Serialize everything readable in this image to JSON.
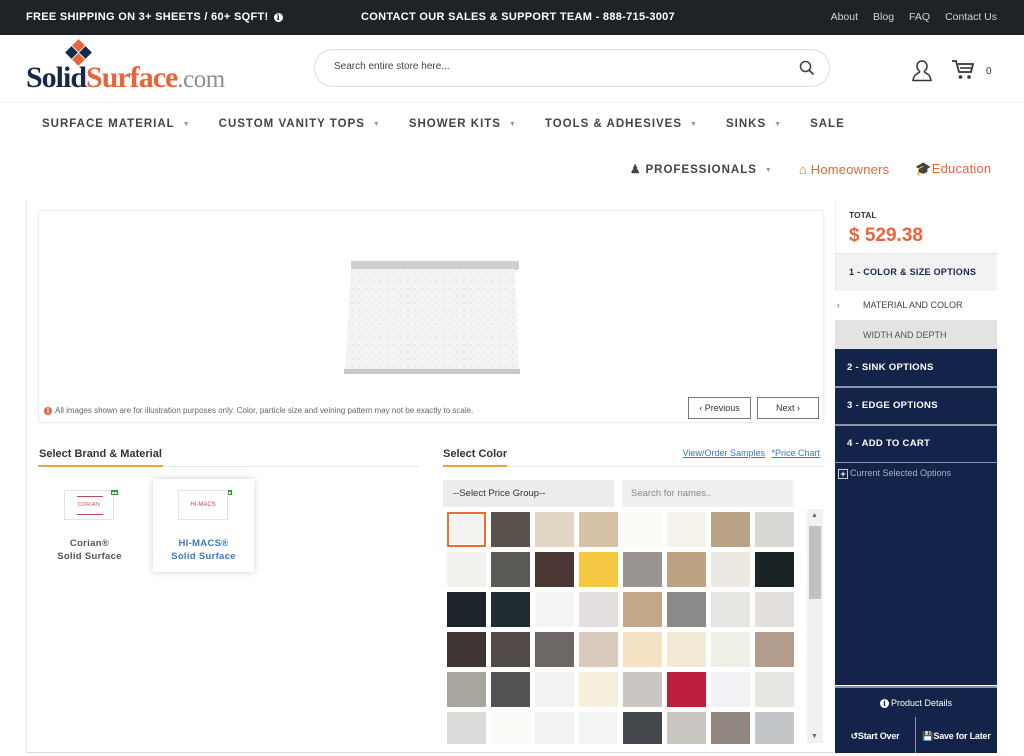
{
  "topbar": {
    "shipping": "FREE SHIPPING ON 3+ SHEETS / 60+ SQFT!",
    "info_icon": "info-circle-icon",
    "contact": "CONTACT OUR SALES & SUPPORT TEAM - 888-715-3007",
    "links": [
      "About",
      "Blog",
      "FAQ",
      "Contact Us"
    ]
  },
  "header": {
    "logo": {
      "part1": "Solid",
      "part2": "Surface",
      "part3": ".com"
    },
    "search_placeholder": "Search entire store here...",
    "cart_count": "0"
  },
  "nav": {
    "main": [
      {
        "label": "SURFACE MATERIAL",
        "dropdown": true
      },
      {
        "label": "CUSTOM VANITY TOPS",
        "dropdown": true
      },
      {
        "label": "SHOWER KITS",
        "dropdown": true
      },
      {
        "label": "TOOLS & ADHESIVES",
        "dropdown": true
      },
      {
        "label": "SINKS",
        "dropdown": true
      },
      {
        "label": "SALE",
        "dropdown": false
      }
    ],
    "professionals": "PROFESSIONALS",
    "homeowners": "Homeowners",
    "education": "Education"
  },
  "viewer": {
    "note": "All images shown are for illustration purposes only. Color, particle size and veining pattern may not be exactly to scale.",
    "previous": "‹ Previous",
    "next": "Next ›"
  },
  "brand": {
    "title": "Select Brand & Material",
    "items": [
      {
        "logo_text": "CORIAN",
        "name1": "Corian®",
        "name2": "Solid Surface",
        "selected": false
      },
      {
        "logo_text": "HI-MACS",
        "name1": "HI-MACS®",
        "name2": "Solid Surface",
        "selected": true
      }
    ]
  },
  "color": {
    "title": "Select Color",
    "view_samples": "View/Order Samples",
    "price_chart": "*Price Chart",
    "price_group": "--Select Price Group--",
    "search_placeholder": "Search for names..",
    "swatches": [
      "#f3f2ef",
      "#5a514c",
      "#e2d6c4",
      "#d6c3a5",
      "#fbfaf7",
      "#f6f1eb",
      "#b9a285",
      "#d9d8d5",
      "#f2f1ed",
      "#5b5955",
      "#4a3632",
      "#f5c842",
      "#9a9490",
      "#bea284",
      "#ece9e3",
      "#1a2326",
      "#1c2329",
      "#1f2a31",
      "#f5f5f3",
      "#e2dfde",
      "#c1a888",
      "#8a8a88",
      "#e4e6e2",
      "#e2dfdc",
      "#3f3634",
      "#514a46",
      "#6c6764",
      "#d8cbbd",
      "#f3e3c4",
      "#f2ead4",
      "#f0efe6",
      "#b29d8d",
      "#a8a69f",
      "#515355",
      "#f3f3f5",
      "#f5efdc",
      "#c9c6c3",
      "#bc1e3c",
      "#f3f3f5",
      "#e8e6e2",
      "#dcdcdb",
      "#fcfaf7",
      "#f1f2f2",
      "#f4f4f5",
      "#43474c",
      "#c9c5c1",
      "#928680",
      "#c3c6c9"
    ],
    "selected_index": 0
  },
  "summary": {
    "total_label": "TOTAL",
    "total_amount": "$ 529.38",
    "step1": "1 - COLOR & SIZE OPTIONS",
    "step1_sub": [
      "MATERIAL AND COLOR",
      "WIDTH AND DEPTH"
    ],
    "step2": "2 - SINK OPTIONS",
    "step3": "3 - EDGE OPTIONS",
    "step4": "4 - ADD TO CART",
    "current_options": "Current Selected Options",
    "product_details": "Product Details",
    "start_over": "Start Over",
    "save_later": "Save for Later"
  },
  "colors": {
    "navy": "#14234a",
    "orange": "#e8643a",
    "link": "#3a78c3"
  }
}
